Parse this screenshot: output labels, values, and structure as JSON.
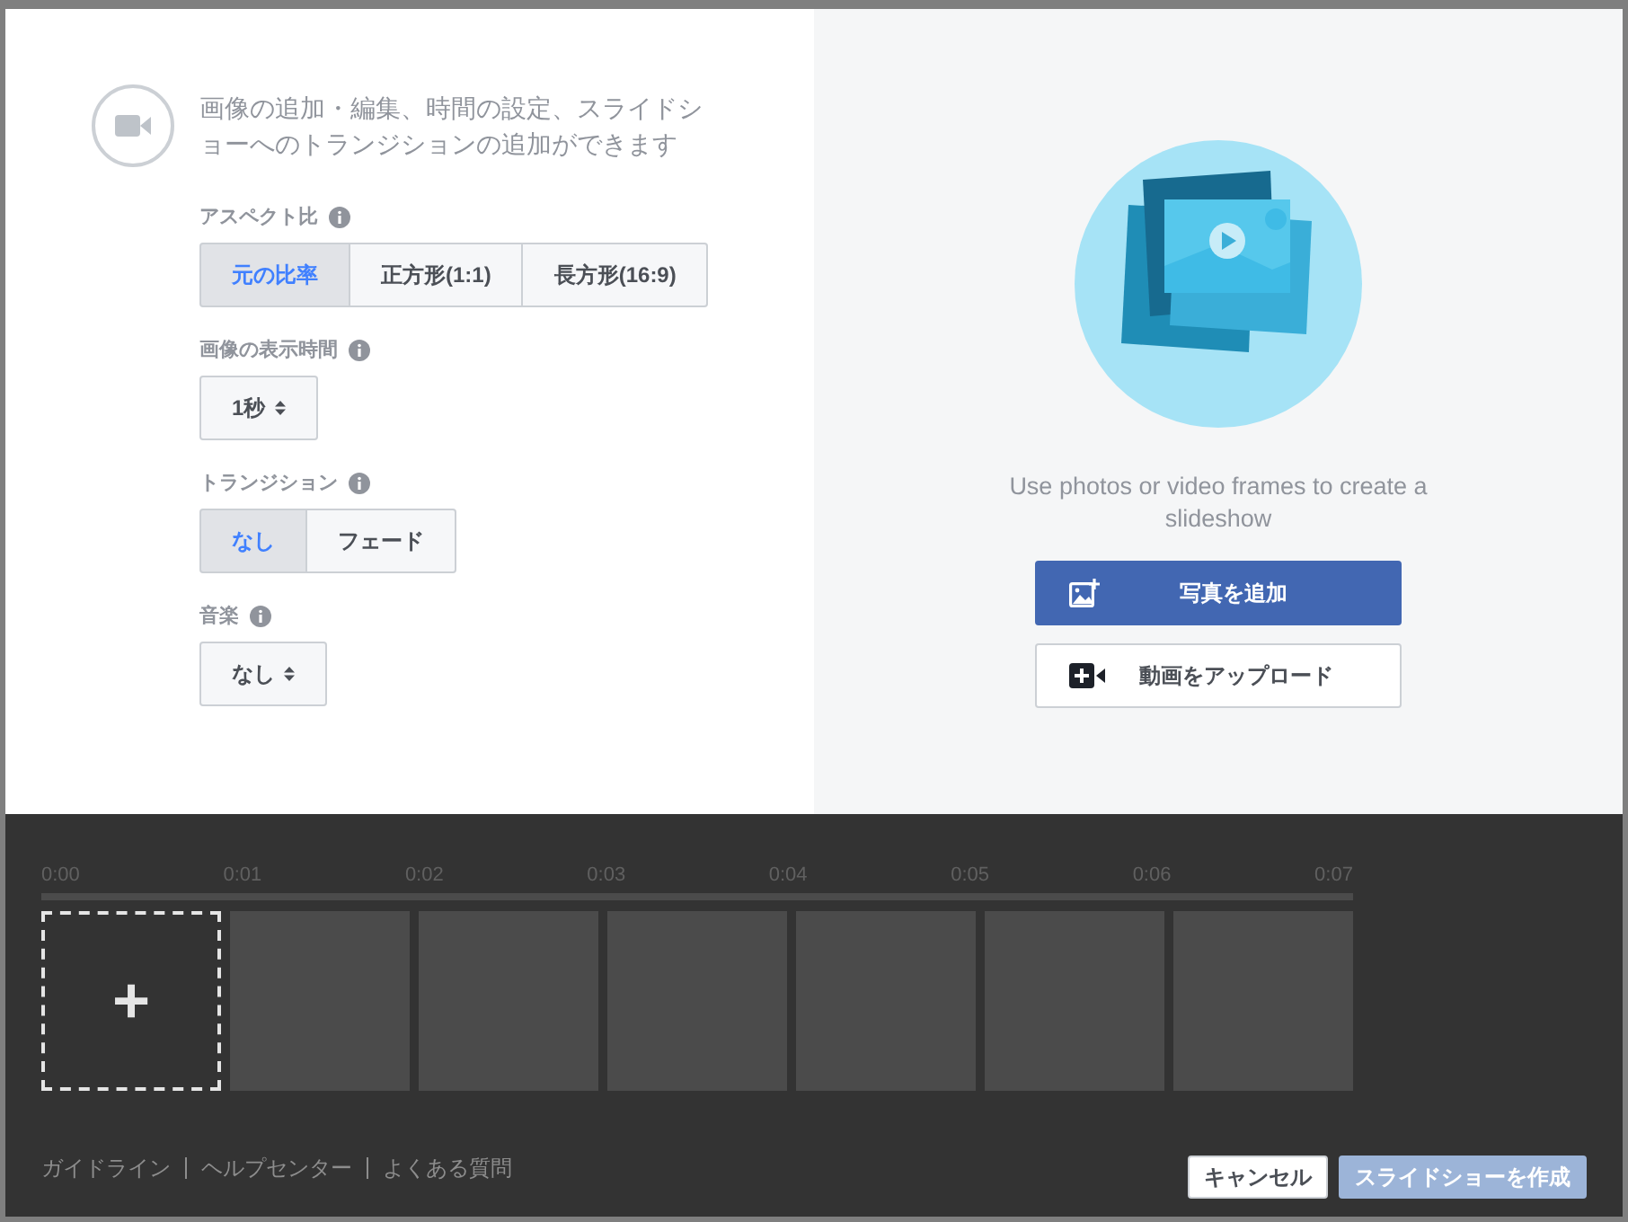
{
  "intro": "画像の追加・編集、時間の設定、スライドショーへのトランジションの追加ができます",
  "settings": [
    {
      "label": "アスペクト比",
      "kind": "segmented",
      "options": [
        {
          "label": "元の比率",
          "selected": true
        },
        {
          "label": "正方形(1:1)",
          "selected": false
        },
        {
          "label": "長方形(16:9)",
          "selected": false
        }
      ]
    },
    {
      "label": "画像の表示時間",
      "kind": "select",
      "value": "1秒"
    },
    {
      "label": "トランジション",
      "kind": "segmented",
      "options": [
        {
          "label": "なし",
          "selected": true
        },
        {
          "label": "フェード",
          "selected": false
        }
      ]
    },
    {
      "label": "音楽",
      "kind": "select",
      "value": "なし"
    }
  ],
  "empty_state": {
    "message": "Use photos or video frames to create a slideshow",
    "primary_button": "写真を追加",
    "secondary_button": "動画をアップロード"
  },
  "timeline": {
    "ticks": [
      "0:00",
      "0:01",
      "0:02",
      "0:03",
      "0:04",
      "0:05",
      "0:06",
      "0:07"
    ],
    "add_slot": "+",
    "slots": [
      {
        "kind": "empty"
      },
      {
        "kind": "empty"
      },
      {
        "kind": "empty"
      },
      {
        "kind": "empty"
      },
      {
        "kind": "empty"
      },
      {
        "kind": "empty"
      }
    ]
  },
  "footer_links": [
    "ガイドライン",
    "ヘルプセンター",
    "よくある質問"
  ],
  "buttons": [
    {
      "label": "キャンセル",
      "kind": "secondary",
      "disabled": false
    },
    {
      "label": "スライドショーを作成",
      "kind": "primary",
      "disabled": true
    }
  ]
}
